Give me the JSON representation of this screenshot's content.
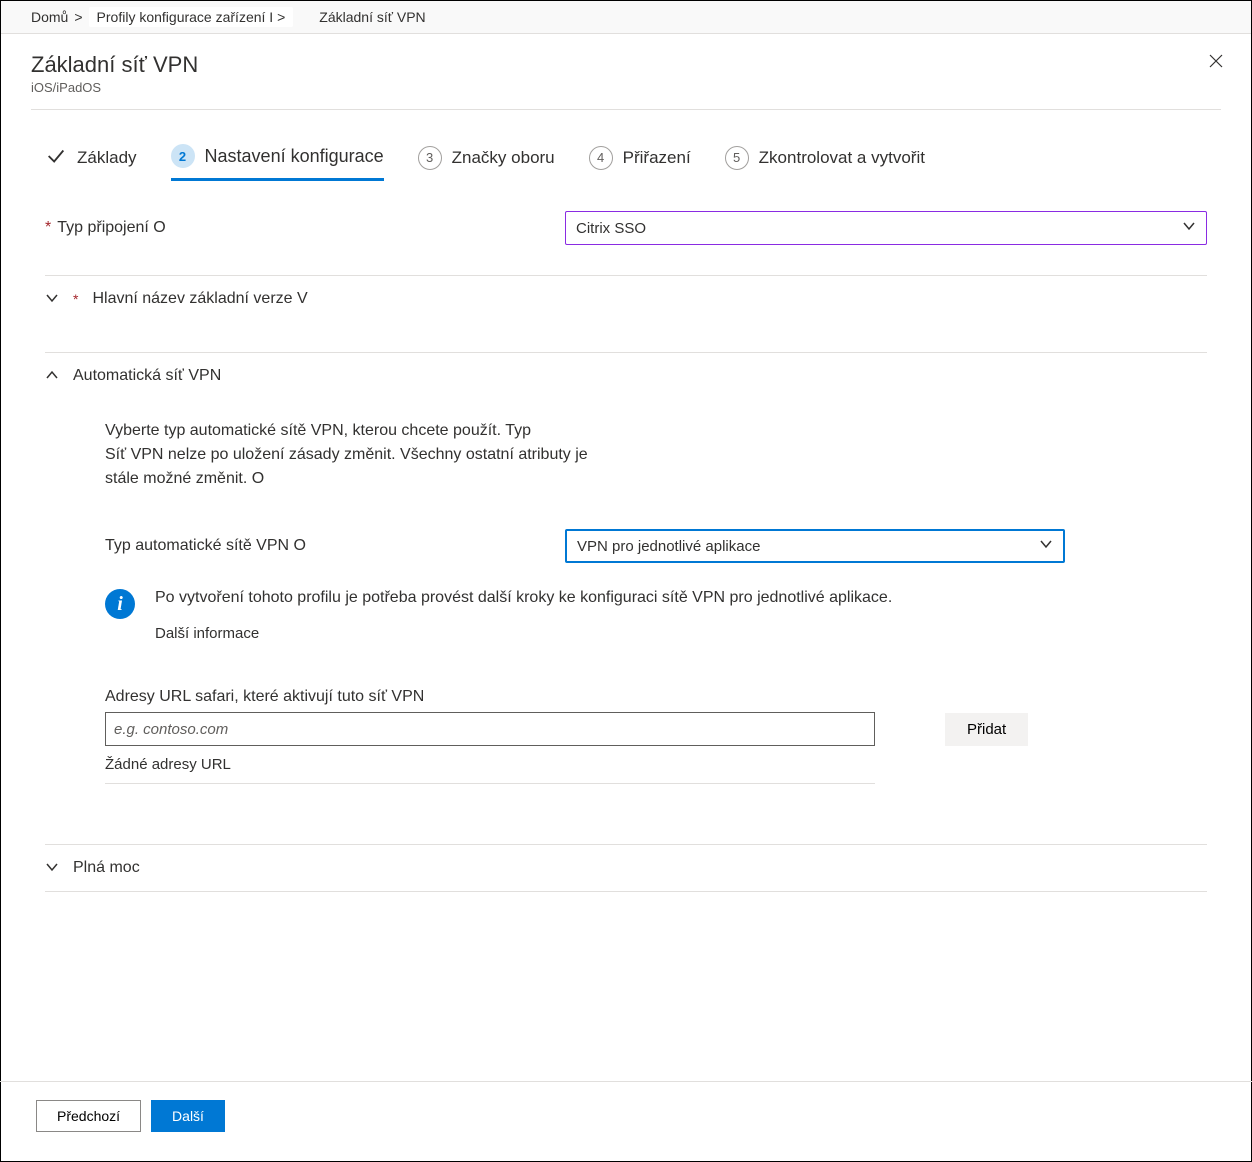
{
  "breadcrumb": {
    "home": "Domů",
    "sep": "&gt;",
    "profiles": "Profily konfigurace zařízení I",
    "current": "Základní síť VPN"
  },
  "panel": {
    "title": "Základní síť VPN",
    "subtitle": "iOS/iPadOS"
  },
  "steps": {
    "s1": "Základy",
    "s2": "Nastavení konfigurace",
    "s3": "Značky oboru",
    "s4": "Přiřazení",
    "s5": "Zkontrolovat a vytvořit",
    "n2": "2",
    "n3": "3",
    "n4": "4",
    "n5": "5"
  },
  "form": {
    "connection_type_label": "Typ připojení O",
    "connection_type_value": "Citrix SSO",
    "section1_title": "Hlavní název základní verze V",
    "section2_title": "Automatická síť VPN",
    "auto_desc_l1": "Vyberte typ automatické sítě VPN, kterou chcete použít. Typ",
    "auto_desc_l2": "Síť VPN nelze po uložení zásady změnit. Všechny ostatní atributy je",
    "auto_desc_l3": "stále možné změnit. O",
    "auto_type_label": "Typ automatické sítě VPN O",
    "auto_type_value": "VPN pro jednotlivé aplikace",
    "info_text": "Po vytvoření tohoto profilu je potřeba provést další kroky ke konfiguraci sítě VPN pro jednotlivé aplikace.",
    "info_link": "Další informace",
    "url_label": "Adresy URL safari, které aktivují tuto síť VPN",
    "url_placeholder": "e.g. contoso.com",
    "add_button": "Přidat",
    "no_urls": "Žádné adresy URL",
    "section3_title": "Plná moc"
  },
  "footer": {
    "previous": "Předchozí",
    "next": "Další"
  }
}
